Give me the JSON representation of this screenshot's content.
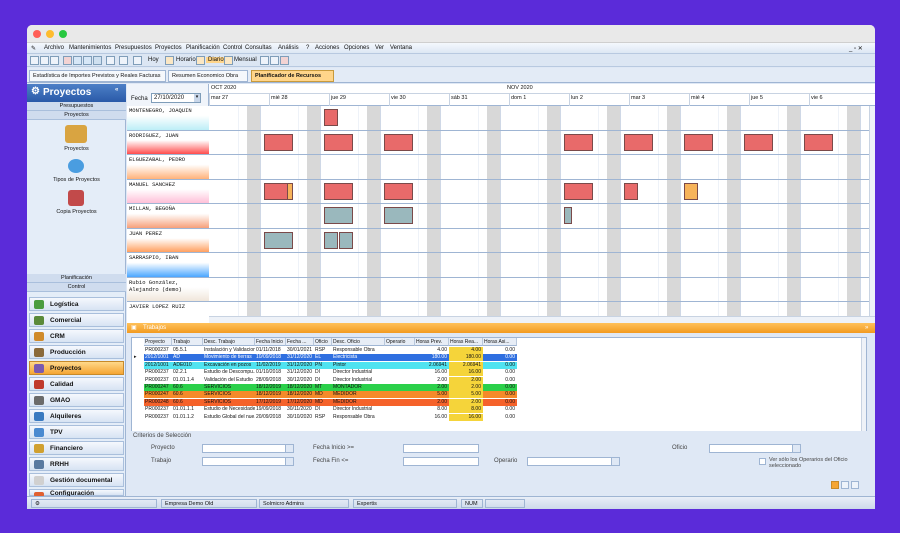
{
  "window": {
    "close_color": "#ff5f57",
    "min_color": "#febc2e",
    "max_color": "#28c840"
  },
  "menu": [
    "Archivo",
    "Mantenimientos",
    "Presupuestos",
    "Proyectos",
    "Planificación",
    "Control",
    "Consultas",
    "Análisis",
    "?",
    "Acciones",
    "Opciones",
    "Ver",
    "Ventana"
  ],
  "toolbar": {
    "hoy": "Hoy",
    "horario": "Horario",
    "diario": "Diario",
    "mensual": "Mensual"
  },
  "tabs": [
    "Estadística de Importes Previstos y Reales Facturas",
    "Resumen Economico Obra",
    "Planificador de Recursos"
  ],
  "sidebar": {
    "title": "Proyectos",
    "sub_top": [
      "Presupuestos",
      "Proyectos"
    ],
    "items": [
      "Proyectos",
      "Tipos de Proyectos",
      "Copia Proyectos"
    ],
    "sub_bottom": [
      "Planificación",
      "Control"
    ],
    "modules": [
      "Logística",
      "Comercial",
      "CRM",
      "Producción",
      "Proyectos",
      "Calidad",
      "GMAO",
      "Alquileres",
      "TPV",
      "Financiero",
      "RRHH",
      "Gestión documental",
      "Configuración"
    ]
  },
  "scheduler": {
    "fecha_label": "Fecha",
    "fecha_value": "27/10/2020",
    "month1": "OCT 2020",
    "month2": "NOV 2020",
    "days": [
      "mar 27",
      "mié 28",
      "jue 29",
      "vie 30",
      "sáb 31",
      "dom 1",
      "lun 2",
      "mar 3",
      "mié 4",
      "jue 5",
      "vie 6"
    ],
    "resources": [
      "MONTENEGRO, JOAQUIN",
      "RODRIGUEZ, JUAN",
      "ELGUEZABAL, PEDRO",
      "MANUEL SANCHEZ",
      "MILLAN, BEGOÑA",
      "JUAN PEREZ",
      "SARRASPIO, IBAN",
      "Rubio González, Alejandro (demo)",
      "JAVIER LOPEZ RUIZ"
    ]
  },
  "trabajos": {
    "title": "Trabajos",
    "headers": [
      "Proyecto",
      "Trabajo",
      "Desc. Trabajo",
      "Fecha Inicio",
      "Fecha ...",
      "Oficio",
      "Desc. Oficio",
      "Operario",
      "Horas Prev.",
      "Horas Rea...",
      "Horas Asi..."
    ],
    "rows": [
      [
        "PR000237",
        "05.5.1",
        "Instalación y Validacion",
        "01/11/2018",
        "30/01/2021",
        "RSP",
        "Responsable Obra",
        "",
        "4.00",
        "4.00",
        "0.00"
      ],
      [
        "2012/1001",
        "AD",
        "Movimiento de tierras",
        "10/09/2018",
        "31/12/2020",
        "EL",
        "Electricista",
        "",
        "180.00",
        "180.00",
        "0.00"
      ],
      [
        "2012/1001",
        "ADE010",
        "Excavación en pozos",
        "11/02/2019",
        "31/12/2020",
        "PN",
        "Pintor",
        "",
        "2.06941",
        "2.06941",
        "0.00"
      ],
      [
        "PR000237",
        "02.2.1",
        "Estudio de Descompu...",
        "01/10/2018",
        "31/12/2020",
        "DI",
        "Director Industrial",
        "",
        "16.00",
        "16.00",
        "0.00"
      ],
      [
        "PR000237",
        "01.01.1.4",
        "Validación del Estudio",
        "28/09/2018",
        "30/12/2020",
        "DI",
        "Director Industrial",
        "",
        "2.00",
        "2.00",
        "0.00"
      ],
      [
        "PR000247",
        "60.6",
        "SERVICIOS",
        "18/12/2019",
        "18/12/2020",
        "MT",
        "MONTADOR",
        "",
        "2.00",
        "2.00",
        "0.00"
      ],
      [
        "PR000247",
        "60.6",
        "SERVICIOS",
        "18/12/2019",
        "18/12/2020",
        "MD",
        "MEDIDOR",
        "",
        "5.00",
        "5.00",
        "0.00"
      ],
      [
        "PR000248",
        "60.6",
        "SERVICIOS",
        "17/12/2019",
        "17/12/2020",
        "MD",
        "MEDIDOR",
        "",
        "2.00",
        "2.00",
        "0.00"
      ],
      [
        "PR000237",
        "01.01.1.1",
        "Estudio de Necesidades",
        "19/09/2018",
        "30/11/2020",
        "DI",
        "Director Industrial",
        "",
        "8.00",
        "8.00",
        "0.00"
      ],
      [
        "PR000237",
        "01.01.1.2",
        "Estudio Global del nue...",
        "20/09/2018",
        "30/10/2020",
        "RSP",
        "Responsable Obra",
        "",
        "16.00",
        "16.00",
        "0.00"
      ]
    ]
  },
  "criterios": {
    "title": "Criterios de Selección",
    "proyecto": "Proyecto",
    "trabajo": "Trabajo",
    "fecha_inicio": "Fecha Inicio >=",
    "fecha_fin": "Fecha Fin <=",
    "operario": "Operario",
    "oficio": "Oficio",
    "check": "Ver sólo los Operarios del Oficio seleccionado"
  },
  "status": {
    "empresa": "Empresa Demo Old",
    "user": "Solmicro Admins",
    "app": "Expertis",
    "num": "NUM"
  }
}
